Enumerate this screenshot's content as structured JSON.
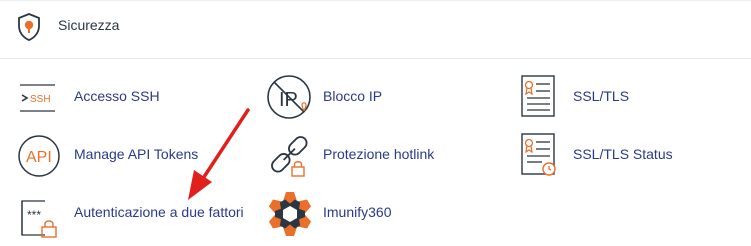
{
  "section": {
    "title": "Sicurezza",
    "icon": "shield-icon",
    "accent_color": "#e8702a",
    "link_color": "#293a8c",
    "annotation_color": "#e0201c"
  },
  "tools": [
    {
      "id": "ssh",
      "label": "Accesso SSH",
      "icon": "ssh-terminal-icon"
    },
    {
      "id": "ipblock",
      "label": "Blocco IP",
      "icon": "ip-block-icon"
    },
    {
      "id": "ssltls",
      "label": "SSL/TLS",
      "icon": "certificate-icon"
    },
    {
      "id": "api",
      "label": "Manage API Tokens",
      "icon": "api-icon"
    },
    {
      "id": "hotlink",
      "label": "Protezione hotlink",
      "icon": "chain-lock-icon"
    },
    {
      "id": "sslstatus",
      "label": "SSL/TLS Status",
      "icon": "certificate-status-icon"
    },
    {
      "id": "2fa",
      "label": "Autenticazione a due fattori",
      "icon": "password-lock-icon"
    },
    {
      "id": "imunify",
      "label": "Imunify360",
      "icon": "imunify-logo-icon"
    }
  ]
}
